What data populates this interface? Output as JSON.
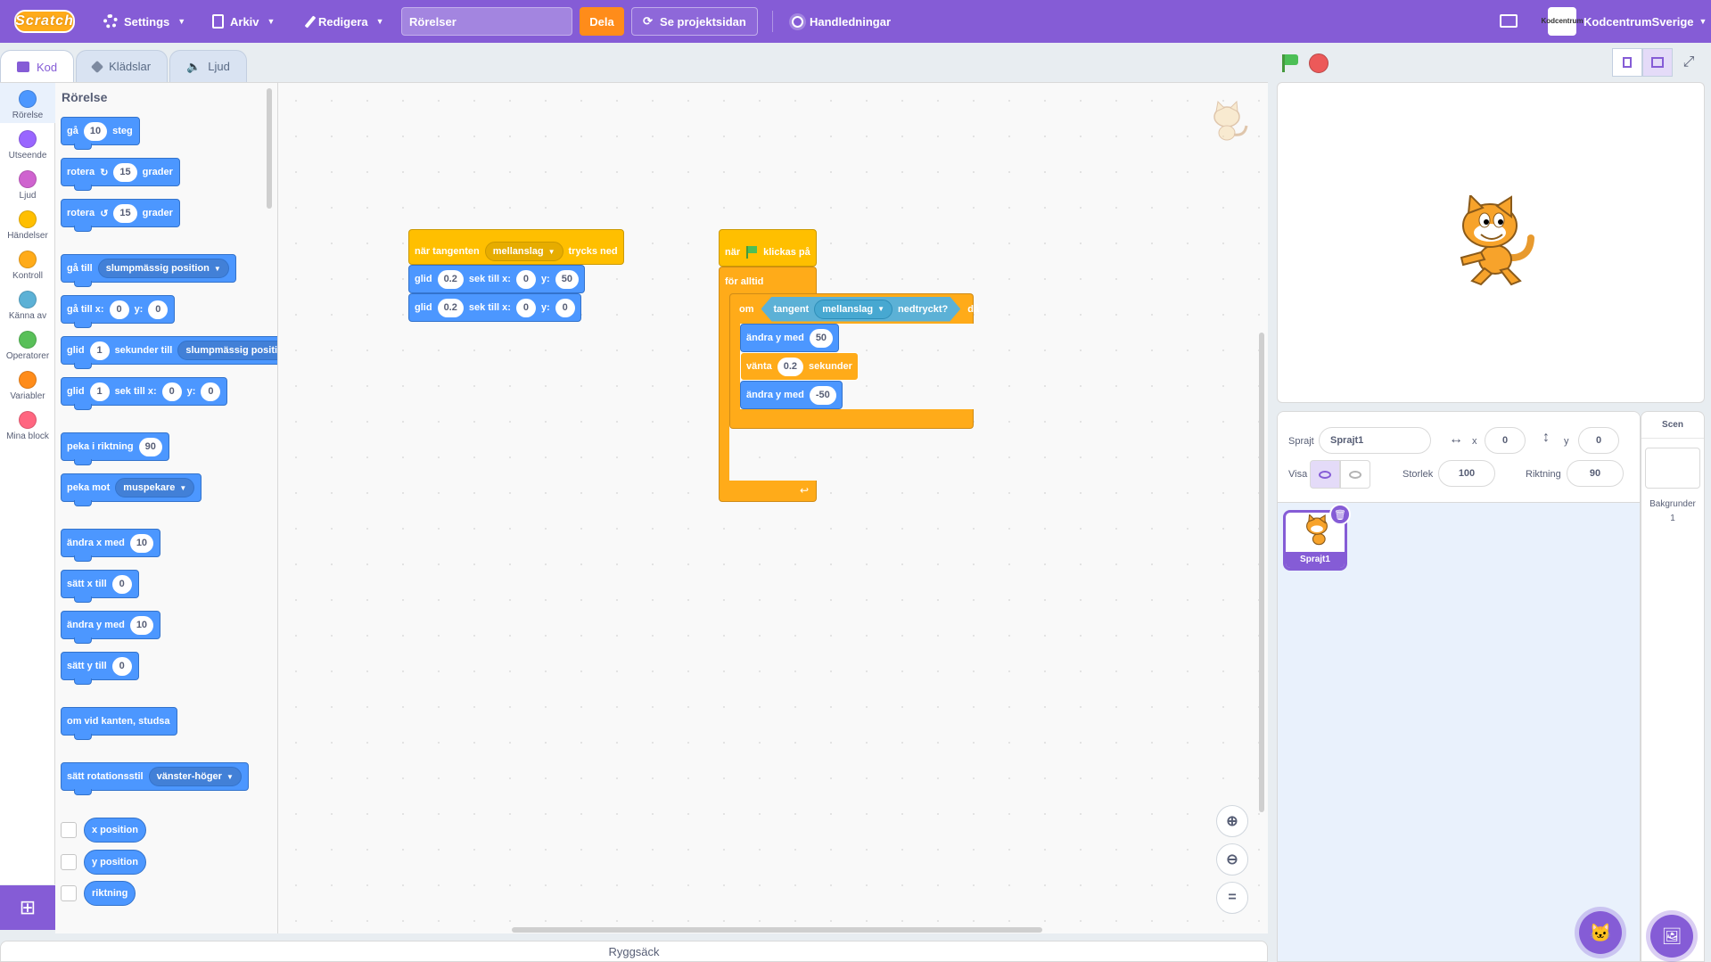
{
  "menu": {
    "logo": "Scratch",
    "settings": "Settings",
    "file": "Arkiv",
    "edit": "Redigera",
    "project_title": "Rörelser",
    "share": "Dela",
    "see_project": "Se projektsidan",
    "tutorials": "Handledningar",
    "user_avatar": "Kodcentrum",
    "username": "KodcentrumSverige"
  },
  "tabs": [
    "Kod",
    "Klädslar",
    "Ljud"
  ],
  "categories": [
    {
      "label": "Rörelse",
      "color": "#4c97ff"
    },
    {
      "label": "Utseende",
      "color": "#9966ff"
    },
    {
      "label": "Ljud",
      "color": "#cf63cf"
    },
    {
      "label": "Händelser",
      "color": "#ffbf00"
    },
    {
      "label": "Kontroll",
      "color": "#ffab19"
    },
    {
      "label": "Känna av",
      "color": "#5cb1d6"
    },
    {
      "label": "Operatorer",
      "color": "#59c059"
    },
    {
      "label": "Variabler",
      "color": "#ff8c1a"
    },
    {
      "label": "Mina block",
      "color": "#ff6680"
    }
  ],
  "palette": {
    "title": "Rörelse",
    "move": {
      "a": "gå",
      "val": "10",
      "b": "steg"
    },
    "turn_right": {
      "a": "rotera",
      "val": "15",
      "b": "grader"
    },
    "turn_left": {
      "a": "rotera",
      "val": "15",
      "b": "grader"
    },
    "goto": {
      "a": "gå till",
      "dd": "slumpmässig position"
    },
    "gotoxy": {
      "a": "gå till x:",
      "x": "0",
      "b": "y:",
      "y": "0"
    },
    "glide_to": {
      "a": "glid",
      "val": "1",
      "b": "sekunder till",
      "dd": "slumpmässig position"
    },
    "glide_xy": {
      "a": "glid",
      "val": "1",
      "b": "sek till x:",
      "x": "0",
      "c": "y:",
      "y": "0"
    },
    "point_dir": {
      "a": "peka i riktning",
      "val": "90"
    },
    "point_towards": {
      "a": "peka mot",
      "dd": "muspekare"
    },
    "change_x": {
      "a": "ändra x med",
      "val": "10"
    },
    "set_x": {
      "a": "sätt x till",
      "val": "0"
    },
    "change_y": {
      "a": "ändra y med",
      "val": "10"
    },
    "set_y": {
      "a": "sätt y till",
      "val": "0"
    },
    "bounce": "om vid kanten, studsa",
    "rotation_style": {
      "a": "sätt rotationsstil",
      "dd": "vänster-höger"
    },
    "reporters": [
      "x position",
      "y position",
      "riktning"
    ]
  },
  "script1": {
    "hat": {
      "a": "när tangenten",
      "dd": "mellanslag",
      "b": "trycks ned"
    },
    "glide1": {
      "a": "glid",
      "val": "0.2",
      "b": "sek till x:",
      "x": "0",
      "c": "y:",
      "y": "50"
    },
    "glide2": {
      "a": "glid",
      "val": "0.2",
      "b": "sek till x:",
      "x": "0",
      "c": "y:",
      "y": "0"
    }
  },
  "script2": {
    "hat": {
      "a": "när",
      "b": "klickas på"
    },
    "forever": "för alltid",
    "if": {
      "a": "om",
      "b": "då"
    },
    "key_pressed": {
      "a": "tangent",
      "dd": "mellanslag",
      "b": "nedtryckt?"
    },
    "change_y1": {
      "a": "ändra y med",
      "val": "50"
    },
    "wait": {
      "a": "vänta",
      "val": "0.2",
      "b": "sekunder"
    },
    "change_y2": {
      "a": "ändra y med",
      "val": "-50"
    }
  },
  "backpack": "Ryggsäck",
  "sprite_info": {
    "sprite_label": "Sprajt",
    "sprite_name": "Sprajt1",
    "x_label": "x",
    "x": "0",
    "y_label": "y",
    "y": "0",
    "show_label": "Visa",
    "size_label": "Storlek",
    "size": "100",
    "direction_label": "Riktning",
    "direction": "90"
  },
  "sprites": [
    {
      "name": "Sprajt1"
    }
  ],
  "stage_target": {
    "header": "Scen",
    "backdrops_label": "Bakgrunder",
    "backdrops_count": "1"
  }
}
